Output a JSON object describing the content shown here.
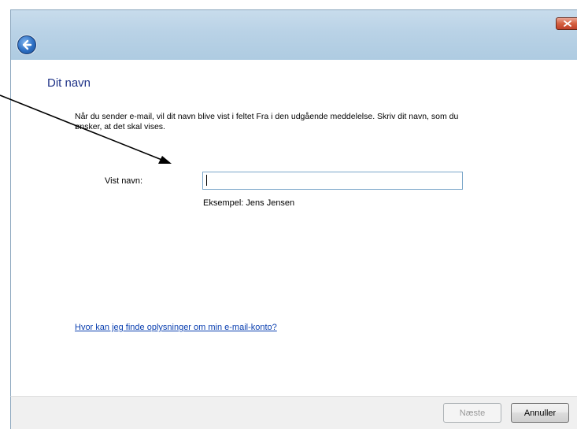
{
  "window": {
    "back_icon": "back-arrow-icon",
    "close_icon": "close-x-icon"
  },
  "page": {
    "heading": "Dit navn",
    "description": "Når du sender e-mail, vil dit navn blive vist i feltet Fra i den udgående meddelelse. Skriv dit navn, som du ønsker, at det skal vises.",
    "display_name_label": "Vist navn:",
    "display_name_value": "",
    "example": "Eksempel: Jens Jensen",
    "help_link": "Hvor kan jeg finde oplysninger om min e-mail-konto?"
  },
  "footer": {
    "next_label": "Næste",
    "cancel_label": "Annuller"
  },
  "annotation": {
    "arrow_color": "#000000"
  }
}
